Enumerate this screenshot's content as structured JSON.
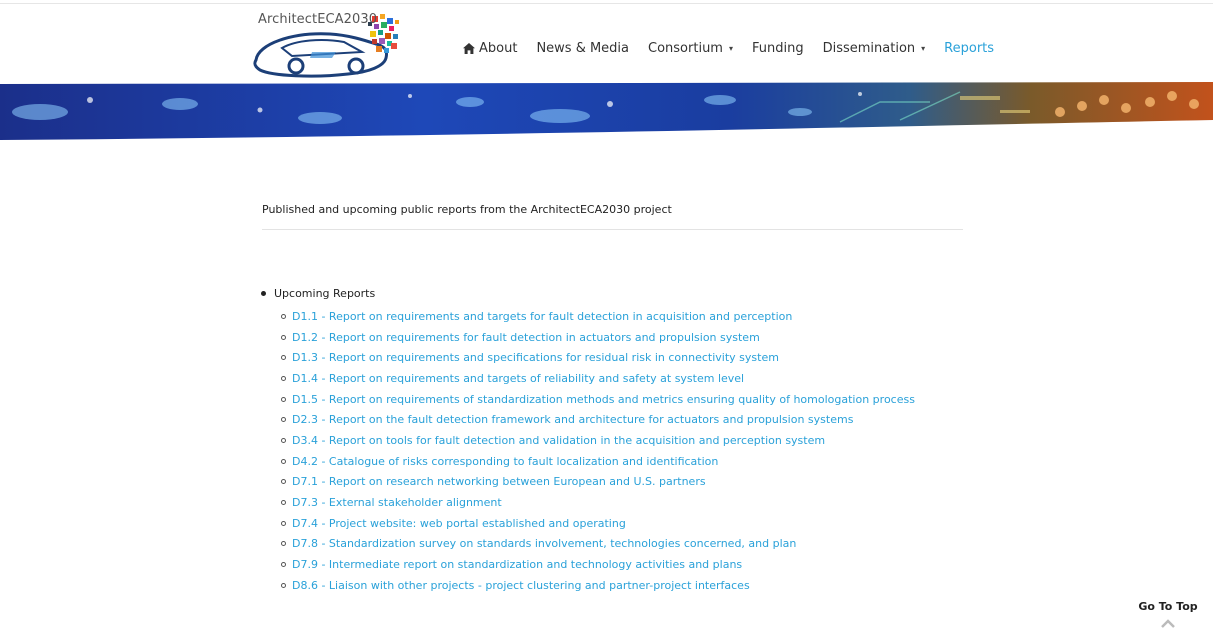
{
  "header": {
    "logo_text": "ArchitectECA2030",
    "nav": [
      {
        "label": "About",
        "icon": "home-icon",
        "dropdown": false,
        "active": false
      },
      {
        "label": "News & Media",
        "dropdown": false,
        "active": false
      },
      {
        "label": "Consortium",
        "dropdown": true,
        "active": false
      },
      {
        "label": "Funding",
        "dropdown": false,
        "active": false
      },
      {
        "label": "Dissemination",
        "dropdown": true,
        "active": false
      },
      {
        "label": "Reports",
        "dropdown": false,
        "active": true
      }
    ]
  },
  "content": {
    "intro": "Published and upcoming public reports from the ArchitectECA2030 project",
    "section_label": "Upcoming Reports",
    "reports": [
      "D1.1 - Report on requirements and targets for fault detection in acquisition and perception",
      "D1.2 - Report on requirements for fault detection in actuators and propulsion system",
      "D1.3 - Report on requirements and specifications for residual risk in connectivity system",
      "D1.4 - Report on requirements and targets of reliability and safety at system level",
      "D1.5 - Report on requirements of standardization methods and metrics ensuring quality of homologation process",
      "D2.3 - Report on the fault detection framework and architecture for actuators and propulsion systems",
      "D3.4 - Report on tools for fault detection and validation in the acquisition and perception system",
      "D4.2 - Catalogue of risks corresponding to fault localization and identification",
      "D7.1 - Report on research networking between European and U.S. partners",
      "D7.3 - External stakeholder alignment",
      "D7.4 - Project website: web portal established and operating",
      "D7.8 - Standardization survey on standards involvement, technologies concerned, and plan",
      "D7.9 - Intermediate report on standardization and technology activities and plans",
      "D8.6 - Liaison with other projects - project clustering and partner-project interfaces"
    ]
  },
  "footer": {
    "go_to_top": "Go To Top"
  },
  "colors": {
    "link": "#2aa1d9",
    "text": "#222222",
    "active_nav": "#2aa1d9"
  }
}
